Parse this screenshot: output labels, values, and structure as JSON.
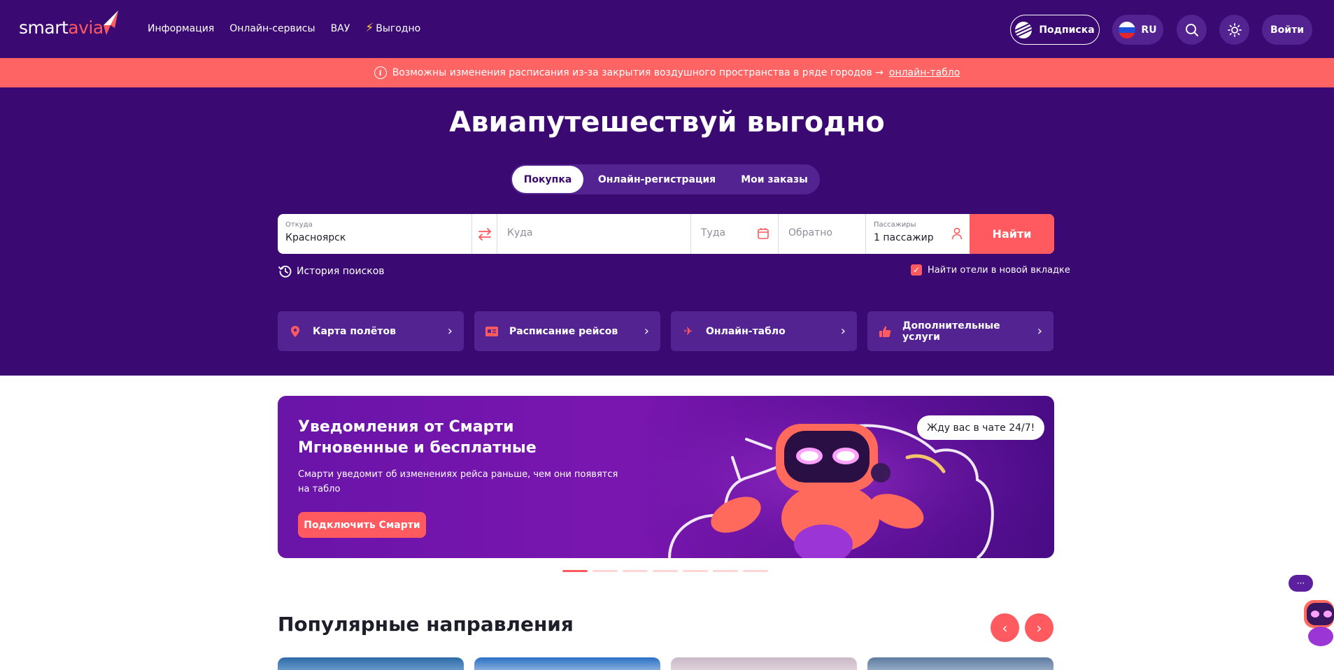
{
  "header": {
    "logo": {
      "part1": "smart",
      "part2": "avia"
    },
    "nav": [
      {
        "label": "Информация"
      },
      {
        "label": "Онлайн-сервисы"
      },
      {
        "label": "ВАУ"
      },
      {
        "label": "Выгодно"
      }
    ],
    "subscription_label": "Подписка",
    "language": "RU",
    "login_label": "Войти"
  },
  "alert": {
    "text": "Возможны изменения расписания из-за закрытия воздушного пространства в ряде городов →",
    "link": "онлайн-табло"
  },
  "hero": {
    "title": "Авиапутешествуй выгодно",
    "tabs": [
      "Покупка",
      "Онлайн-регистрация",
      "Мои заказы"
    ],
    "search": {
      "from_label": "Откуда",
      "from_value": "Красноярск",
      "to_placeholder": "Куда",
      "depart_placeholder": "Туда",
      "return_placeholder": "Обратно",
      "passengers_label": "Пассажиры",
      "passengers_value": "1 пассажир",
      "find_label": "Найти"
    },
    "history_label": "История поисков",
    "hotels_checkbox_label": "Найти отели в новой вкладке",
    "quick_links": [
      {
        "label": "Карта полётов",
        "icon": "map-pin-icon"
      },
      {
        "label": "Расписание рейсов",
        "icon": "schedule-icon"
      },
      {
        "label": "Онлайн-табло",
        "icon": "plane-icon"
      },
      {
        "label": "Дополнительные услуги",
        "icon": "thumbs-up-icon"
      }
    ]
  },
  "banner": {
    "title_line1": "Уведомления от Смарти",
    "title_line2": "Мгновенные и бесплатные",
    "text": "Смарти уведомит об изменениях рейса раньше, чем они появятся на табло",
    "button_label": "Подключить Смарти",
    "bubble_text": "Жду вас в чате 24/7!",
    "slide_count": 7,
    "active_slide": 1
  },
  "popular": {
    "title": "Популярные направления"
  },
  "colors": {
    "brand_purple": "#3a0a72",
    "accent_coral": "#ff5a5f",
    "alert_bg": "#ff6464"
  }
}
